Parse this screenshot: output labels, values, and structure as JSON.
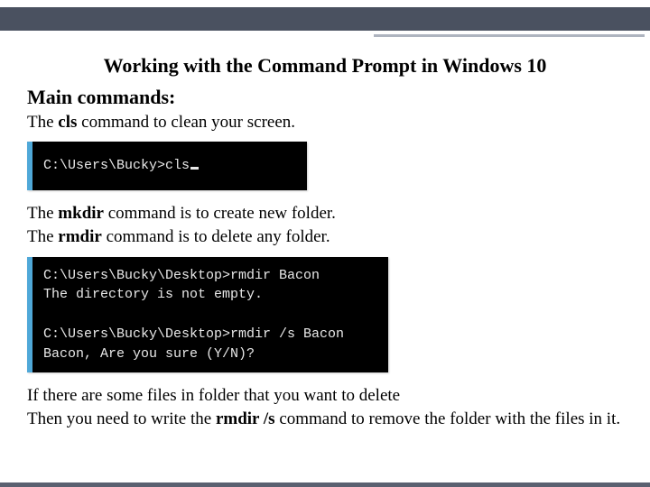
{
  "title": "Working with the Command Prompt in Windows 10",
  "heading": "Main commands:",
  "p1": {
    "pre": "The ",
    "cmd": "cls",
    "post": " command to clean your screen."
  },
  "term1": {
    "prompt": "C:\\Users\\Bucky>",
    "cmd": "cls"
  },
  "p2": {
    "pre": "The ",
    "cmd": "mkdir",
    "post": " command is to create new folder."
  },
  "p3": {
    "pre": "The ",
    "cmd": "rmdir",
    "post": " command is to delete any folder."
  },
  "term2": {
    "l1": "C:\\Users\\Bucky\\Desktop>rmdir Bacon",
    "l2": "The directory is not empty.",
    "l3": "",
    "l4": "C:\\Users\\Bucky\\Desktop>rmdir /s Bacon",
    "l5": "Bacon, Are you sure (Y/N)?"
  },
  "p4": "If there are some files in folder that you want to delete",
  "p5": {
    "pre": "Then you need to write the ",
    "cmd": "rmdir /s",
    "post": " command to remove the folder with the files in it."
  }
}
